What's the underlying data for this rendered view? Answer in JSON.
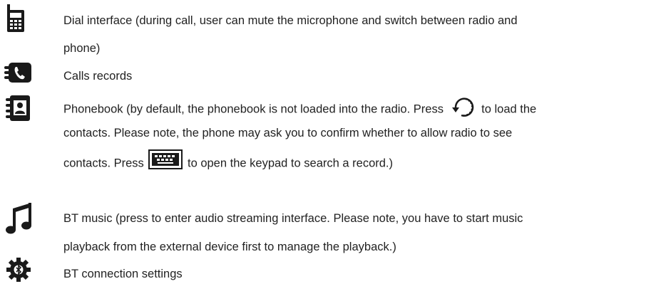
{
  "items": [
    {
      "icon": "phone-dial-icon",
      "line1": "Dial interface (during call, user can mute the microphone and switch between radio and",
      "line2": "phone)"
    },
    {
      "icon": "call-records-icon",
      "line1": "Calls records"
    },
    {
      "icon": "phonebook-icon",
      "line1_a": "Phonebook (by default, the phonebook is not loaded into the radio. Press",
      "line1_b": "to load the",
      "line2": "contacts. Please note, the phone may ask you to confirm whether to allow radio to see",
      "line3_a": "contacts. Press",
      "line3_b": "to open the keypad to search a record.)",
      "refresh_icon": "refresh-icon",
      "keypad_icon": "keypad-icon"
    },
    {
      "icon": "music-note-icon",
      "line1": "BT music (press to enter audio streaming interface. Please note, you have to start music",
      "line2": "playback from the external device first to manage the playback.)"
    },
    {
      "icon": "bt-settings-gear-icon",
      "line1": "BT connection settings"
    }
  ]
}
